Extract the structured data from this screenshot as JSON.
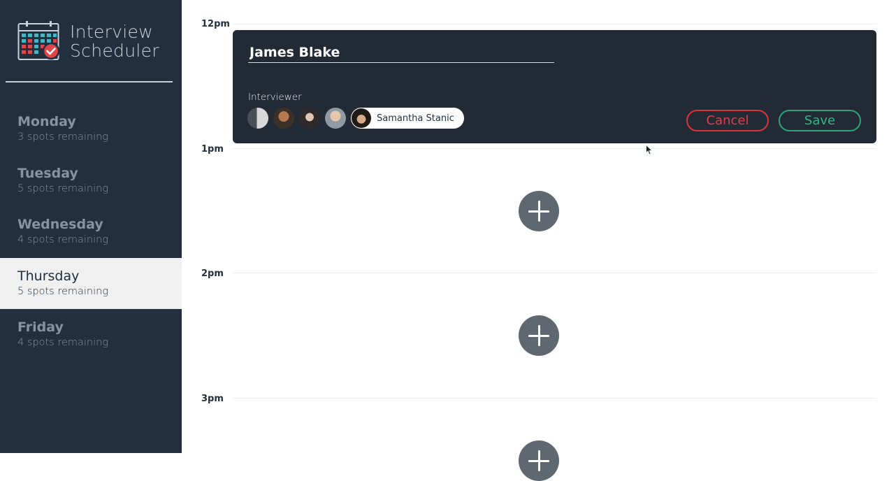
{
  "brand": {
    "line1": "Interview",
    "line2": "Scheduler"
  },
  "sidebar": {
    "days": [
      {
        "name": "Monday",
        "spots": "3 spots remaining",
        "selected": false
      },
      {
        "name": "Tuesday",
        "spots": "5 spots remaining",
        "selected": false
      },
      {
        "name": "Wednesday",
        "spots": "4 spots remaining",
        "selected": false
      },
      {
        "name": "Thursday",
        "spots": "5 spots remaining",
        "selected": true
      },
      {
        "name": "Friday",
        "spots": "4 spots remaining",
        "selected": false
      }
    ]
  },
  "schedule": {
    "times": [
      "12pm",
      "1pm",
      "2pm",
      "3pm"
    ]
  },
  "form": {
    "student_name": "James Blake",
    "interviewer_label": "Interviewer",
    "selected_interviewer": "Samantha Stanic",
    "cancel_label": "Cancel",
    "save_label": "Save"
  },
  "colors": {
    "sidebar_bg": "#222f3e",
    "card_bg": "#222a36",
    "selected_day_bg": "#f0f0f0",
    "cancel": "#e04146",
    "save": "#37b48a",
    "add_button": "#5f6770"
  },
  "icons": {
    "logo": "calendar-check-icon",
    "add": "plus-icon"
  }
}
